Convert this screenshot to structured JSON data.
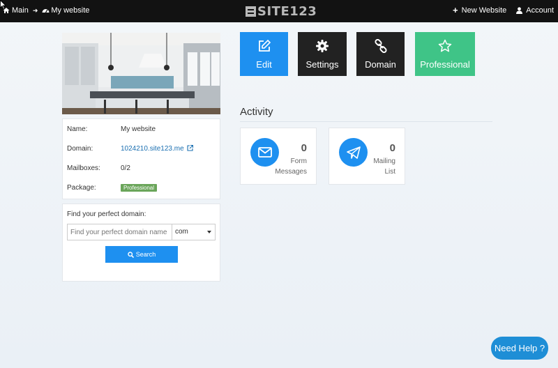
{
  "topbar": {
    "breadcrumb": [
      {
        "label": "Main",
        "icon": "home-icon"
      },
      {
        "label": "My website",
        "icon": "dashboard-icon"
      }
    ],
    "logo_text": "SITE123",
    "new_website_label": "New Website",
    "account_label": "Account"
  },
  "actions": {
    "edit_label": "Edit",
    "settings_label": "Settings",
    "domain_label": "Domain",
    "professional_label": "Professional"
  },
  "site_info": {
    "name_label": "Name:",
    "name_value": "My website",
    "domain_label": "Domain:",
    "domain_value": "1024210.site123.me",
    "mailboxes_label": "Mailboxes:",
    "mailboxes_value": "0/2",
    "package_label": "Package:",
    "package_value": "Professional"
  },
  "domain_search": {
    "title": "Find your perfect domain:",
    "placeholder": "Find your perfect domain name",
    "tld_selected": "com",
    "search_label": "Search"
  },
  "activity": {
    "title": "Activity",
    "stats": [
      {
        "count": "0",
        "line1": "Form",
        "line2": "Messages",
        "icon": "envelope-icon"
      },
      {
        "count": "0",
        "line1": "Mailing",
        "line2": "List",
        "icon": "paper-plane-icon"
      }
    ]
  },
  "help_label": "Need Help ?",
  "colors": {
    "primary_blue": "#1e90f0",
    "dark_tile": "#222222",
    "green_tile": "#3fc487",
    "badge_green": "#6aa55a",
    "topbar": "#121212"
  }
}
